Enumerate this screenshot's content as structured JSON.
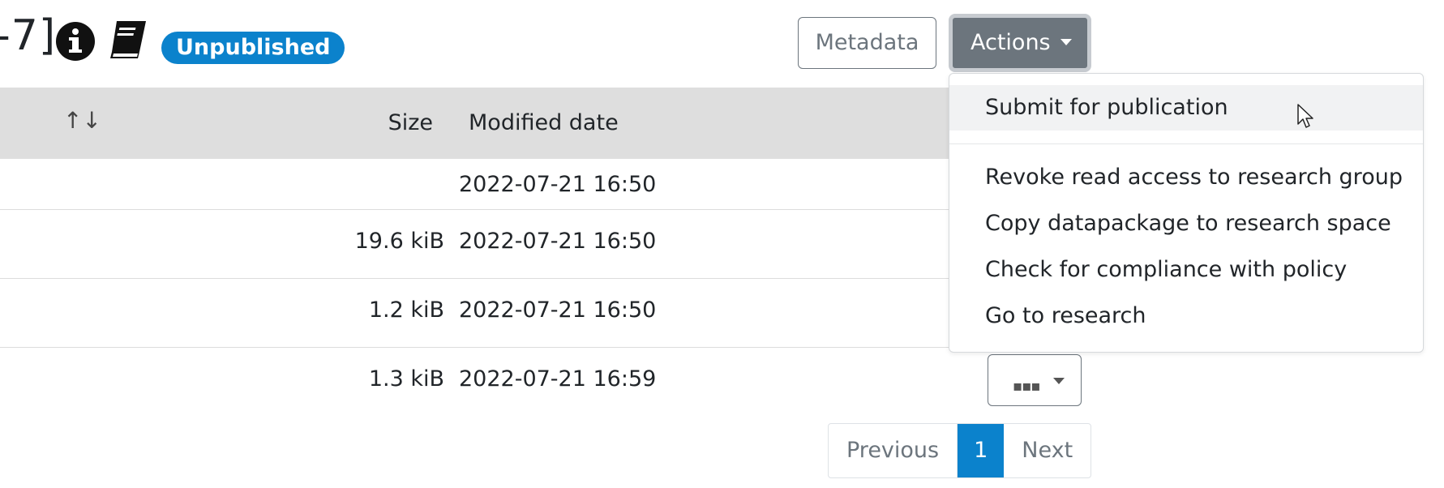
{
  "header": {
    "title_fragment": "-7]",
    "status_badge": "Unpublished",
    "metadata_button": "Metadata",
    "actions_button": "Actions"
  },
  "table": {
    "sort_icon": "↑↓",
    "columns": {
      "size": "Size",
      "modified_date": "Modified date"
    },
    "rows": [
      {
        "size": "",
        "modified_date": "2022-07-21 16:50"
      },
      {
        "size": "19.6 kiB",
        "modified_date": "2022-07-21 16:50"
      },
      {
        "size": "1.2 kiB",
        "modified_date": "2022-07-21 16:50"
      },
      {
        "size": "1.3 kiB",
        "modified_date": "2022-07-21 16:59"
      }
    ],
    "row_menu_label": "▪▪▪"
  },
  "pagination": {
    "previous": "Previous",
    "current": "1",
    "next": "Next"
  },
  "actions_menu": {
    "items": [
      {
        "label": "Submit for publication"
      },
      {
        "label": "Revoke read access to research group"
      },
      {
        "label": "Copy datapackage to research space"
      },
      {
        "label": "Check for compliance with policy"
      },
      {
        "label": "Go to research"
      }
    ]
  },
  "icons": {
    "info": "info-circle-icon",
    "book": "book-icon",
    "sort": "sort-icon",
    "caret": "caret-down-icon",
    "cursor": "mouse-pointer-icon"
  },
  "colors": {
    "accent": "#0b82cc",
    "secondary": "#6c757d",
    "table_header": "#dedede"
  }
}
